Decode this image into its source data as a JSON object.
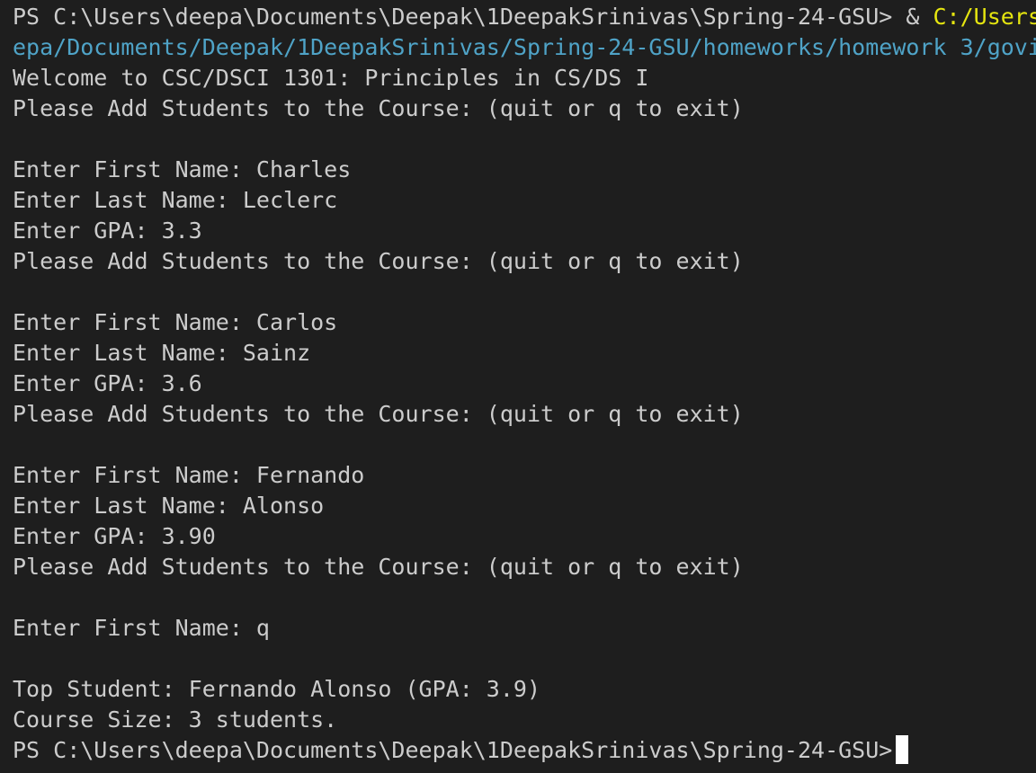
{
  "terminal": {
    "prompt_cmd": {
      "prompt": "PS C:\\Users\\deepa\\Documents\\Deepak\\1DeepakSrinivas\\Spring-24-GSU> ",
      "operator": "& ",
      "path": "C:/Users"
    },
    "cmd_continuation": "epa/Documents/Deepak/1DeepakSrinivas/Spring-24-GSU/homeworks/homework 3/govi",
    "welcome": "Welcome to CSC/DSCI 1301: Principles in CS/DS I",
    "add_prompt": "Please Add Students to the Course: (quit or q to exit)",
    "entries": [
      {
        "first": "Enter First Name: Charles",
        "last": "Enter Last Name: Leclerc",
        "gpa": "Enter GPA: 3.3",
        "add": "Please Add Students to the Course: (quit or q to exit)"
      },
      {
        "first": "Enter First Name: Carlos",
        "last": "Enter Last Name: Sainz",
        "gpa": "Enter GPA: 3.6",
        "add": "Please Add Students to the Course: (quit or q to exit)"
      },
      {
        "first": "Enter First Name: Fernando",
        "last": "Enter Last Name: Alonso",
        "gpa": "Enter GPA: 3.90",
        "add": "Please Add Students to the Course: (quit or q to exit)"
      }
    ],
    "quit_entry": "Enter First Name: q",
    "top_student": "Top Student: Fernando Alonso (GPA: 3.9)",
    "course_size": "Course Size: 3 students.",
    "final_prompt": "PS C:\\Users\\deepa\\Documents\\Deepak\\1DeepakSrinivas\\Spring-24-GSU>"
  },
  "colors": {
    "background": "#1e1e1e",
    "text": "#cccccc",
    "command_path": "#e5e510",
    "continuation_path": "#4fa3c7",
    "cursor": "#ffffff"
  }
}
